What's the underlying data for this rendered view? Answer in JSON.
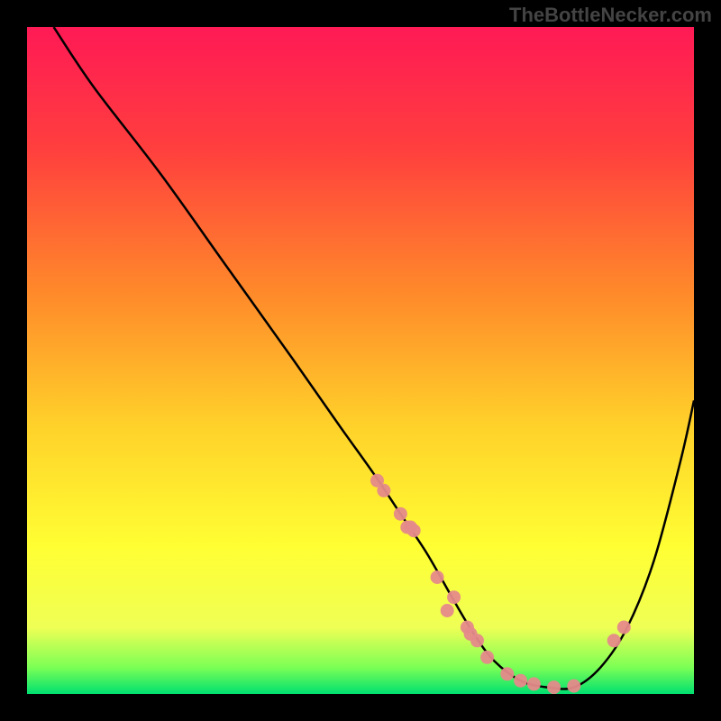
{
  "watermark": "TheBottleNecker.com",
  "chart_data": {
    "type": "line",
    "title": "",
    "xlabel": "",
    "ylabel": "",
    "xlim": [
      0,
      100
    ],
    "ylim": [
      0,
      100
    ],
    "gradient_stops": [
      {
        "offset": 0,
        "color": "#FF1A55"
      },
      {
        "offset": 18,
        "color": "#FF3E3E"
      },
      {
        "offset": 40,
        "color": "#FF8A2A"
      },
      {
        "offset": 60,
        "color": "#FFD22A"
      },
      {
        "offset": 78,
        "color": "#FFFF33"
      },
      {
        "offset": 90,
        "color": "#EFFF55"
      },
      {
        "offset": 96,
        "color": "#7CFF55"
      },
      {
        "offset": 100,
        "color": "#00E070"
      }
    ],
    "series": [
      {
        "name": "curve",
        "x": [
          4,
          10,
          20,
          30,
          40,
          47,
          52,
          56,
          60,
          64,
          67,
          70,
          74,
          78,
          82,
          86,
          90,
          94,
          98,
          100
        ],
        "y": [
          100,
          91,
          78,
          64,
          50,
          40,
          33,
          27,
          21,
          14,
          9,
          5,
          2,
          1,
          1,
          4,
          10,
          20,
          35,
          44
        ]
      }
    ],
    "markers": {
      "name": "highlight-points",
      "color": "#E58A8A",
      "x": [
        52.5,
        53.5,
        56,
        57,
        57.5,
        58,
        61.5,
        63,
        64,
        66,
        66.5,
        67.5,
        69,
        72,
        74,
        76,
        79,
        82,
        88,
        89.5
      ],
      "y": [
        32,
        30.5,
        27,
        25,
        25,
        24.5,
        17.5,
        12.5,
        14.5,
        10,
        9,
        8,
        5.5,
        3,
        2,
        1.5,
        1,
        1.2,
        8,
        10
      ]
    }
  }
}
